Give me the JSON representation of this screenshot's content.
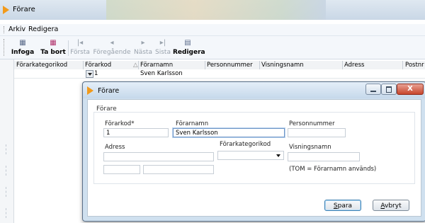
{
  "window": {
    "title": "Förare"
  },
  "menu": {
    "items": [
      "Arkiv",
      "Redigera"
    ]
  },
  "toolbar": {
    "insert": "Infoga",
    "delete": "Ta bort",
    "first": "Första",
    "previous": "Föregående",
    "next": "Nästa",
    "last": "Sista",
    "edit": "Redigera"
  },
  "grid": {
    "columns": [
      "Förarkategorikod",
      "Förarkod",
      "Förarnamn",
      "Personnummer",
      "Visningsnamn",
      "Adress",
      "Postnr"
    ],
    "row": {
      "forarkod": "1",
      "forarnamn": "Sven Karlsson"
    }
  },
  "dialog": {
    "title": "Förare",
    "group": "Förare",
    "labels": {
      "forarkod": "Förarkod*",
      "forarnamn": "Förarnamn",
      "personnummer": "Personnummer",
      "adress": "Adress",
      "forarkategorikod": "Förarkategorikod",
      "visningsnamn": "Visningsnamn",
      "visningsnamn_hint": "(TOM = Förarnamn används)"
    },
    "values": {
      "forarkod": "1",
      "forarnamn": "Sven Karlsson",
      "personnummer": "",
      "adress": "",
      "forarkategorikod": "",
      "visningsnamn": "",
      "postnr": "",
      "postort": ""
    },
    "buttons": {
      "save_rest": "para",
      "save_access": "S",
      "cancel_access": "A",
      "cancel_rest": "vbryt"
    },
    "close_glyph": "X"
  },
  "colors": {
    "accent": "#f29a1a",
    "title_bar": "#c9d7e6"
  }
}
